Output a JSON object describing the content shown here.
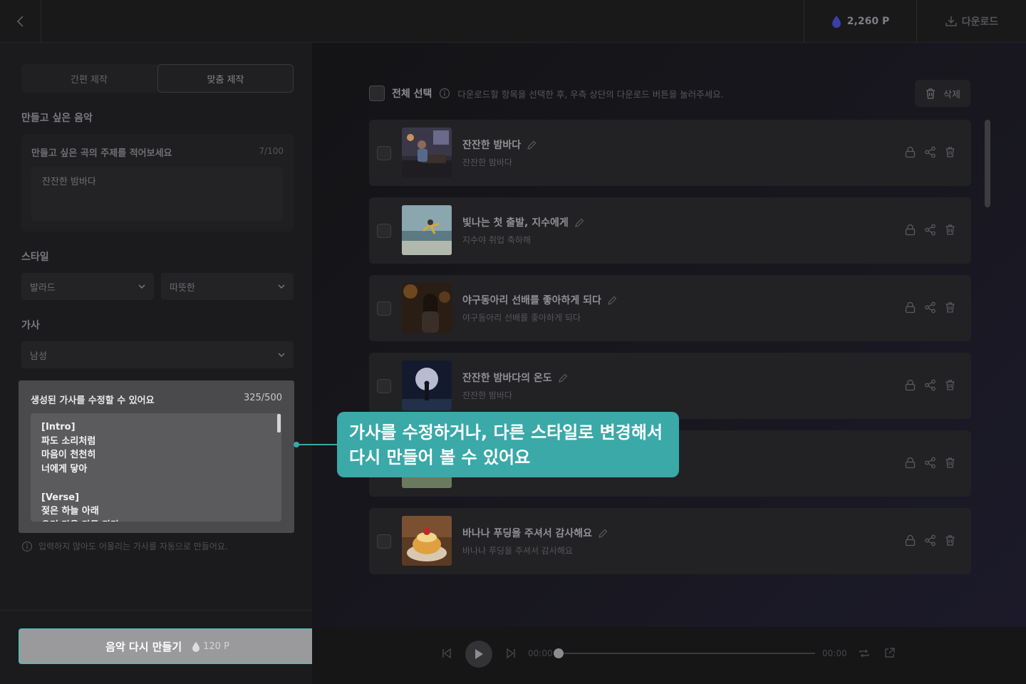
{
  "header": {
    "points": "2,260 P",
    "download_label": "다운로드"
  },
  "left": {
    "tabs": [
      "간편 제작",
      "맞춤 제작"
    ],
    "music_section": "만들고 싶은 음악",
    "topic_label": "만들고 싶은 곡의 주제를 적어보세요",
    "topic_count": "7/100",
    "topic_value": "잔잔한 밤바다",
    "style_section": "스타일",
    "style_genre": "발라드",
    "style_mood": "따뜻한",
    "lyrics_section": "가사",
    "vocal": "남성",
    "lyrics_title": "생성된 가사를 수정할 수 있어요",
    "lyrics_count": "325/500",
    "lyrics_text": "[Intro]\n파도 소리처럼\n마음이 천천히\n너에게 닿아\n\n[Verse]\n젖은 하늘 아래\n우리 마음 가득 가라",
    "hint": "입력하지 않아도 어울리는 가사를 자동으로 만들어요.",
    "regen_label": "음악 다시 만들기",
    "regen_cost": "120 P"
  },
  "list": {
    "select_all": "전체 선택",
    "help": "다운로드할 항목을 선택한 후, 우측 상단의 다운로드 버튼을 눌러주세요.",
    "delete_label": "삭제",
    "items": [
      {
        "title": "잔잔한 밤바다",
        "subtitle": "잔잔한 밤바다"
      },
      {
        "title": "빛나는 첫 출발, 지수에게",
        "subtitle": "지수야 취업 축하해"
      },
      {
        "title": "야구동아리 선배를 좋아하게 되다",
        "subtitle": "야구동아리 선배를 좋아하게 되다"
      },
      {
        "title": "잔잔한 밤바다의 온도",
        "subtitle": "잔잔한 밤바다"
      },
      {
        "title": "",
        "subtitle": ""
      },
      {
        "title": "바나나 푸딩을 주셔서 감사해요",
        "subtitle": "바나나 푸딩을 주셔서 감사해요"
      }
    ]
  },
  "player": {
    "time_start": "00:00",
    "time_end": "00:00",
    "progress": 0
  },
  "callout": {
    "text": "가사를 수정하거나, 다른 스타일로 변경해서\n다시 만들어 볼 수 있어요"
  },
  "colors": {
    "accent": "#3aa9a8",
    "point_drop": "#3b3fa8"
  },
  "icons": [
    "back-icon",
    "drop-icon",
    "download-icon",
    "chevron-down-icon",
    "info-icon",
    "trash-icon",
    "edit-icon",
    "lock-icon",
    "share-icon",
    "prev-icon",
    "play-icon",
    "next-icon",
    "repeat-icon",
    "export-icon"
  ]
}
